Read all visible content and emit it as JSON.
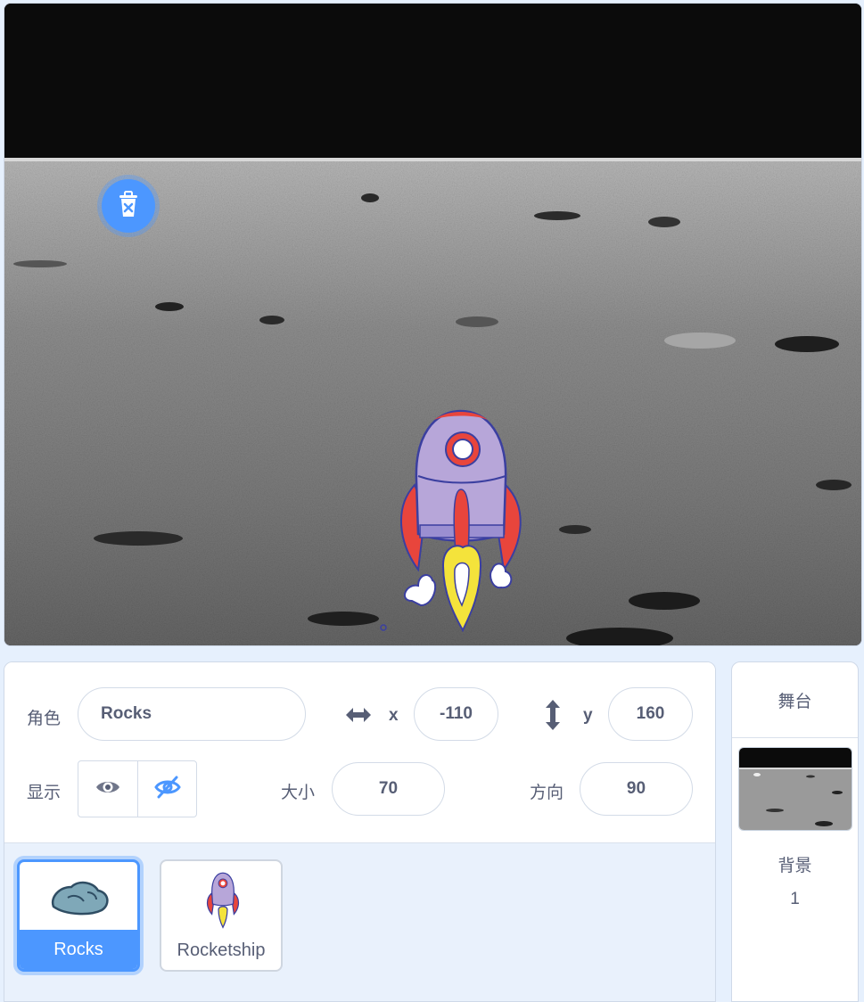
{
  "sprite_info": {
    "sprite_label": "角色",
    "sprite_name": "Rocks",
    "x_label": "x",
    "x_value": "-110",
    "y_label": "y",
    "y_value": "160",
    "show_label": "显示",
    "size_label": "大小",
    "size_value": "70",
    "direction_label": "方向",
    "direction_value": "90"
  },
  "sprites": [
    {
      "name": "Rocks",
      "selected": true
    },
    {
      "name": "Rocketship",
      "selected": false
    }
  ],
  "stage_panel": {
    "title": "舞台",
    "backdrops_label": "背景",
    "backdrops_count": "1"
  },
  "colors": {
    "accent": "#4c97ff",
    "text": "#575e75",
    "panel_bg": "#e6f0fd"
  }
}
